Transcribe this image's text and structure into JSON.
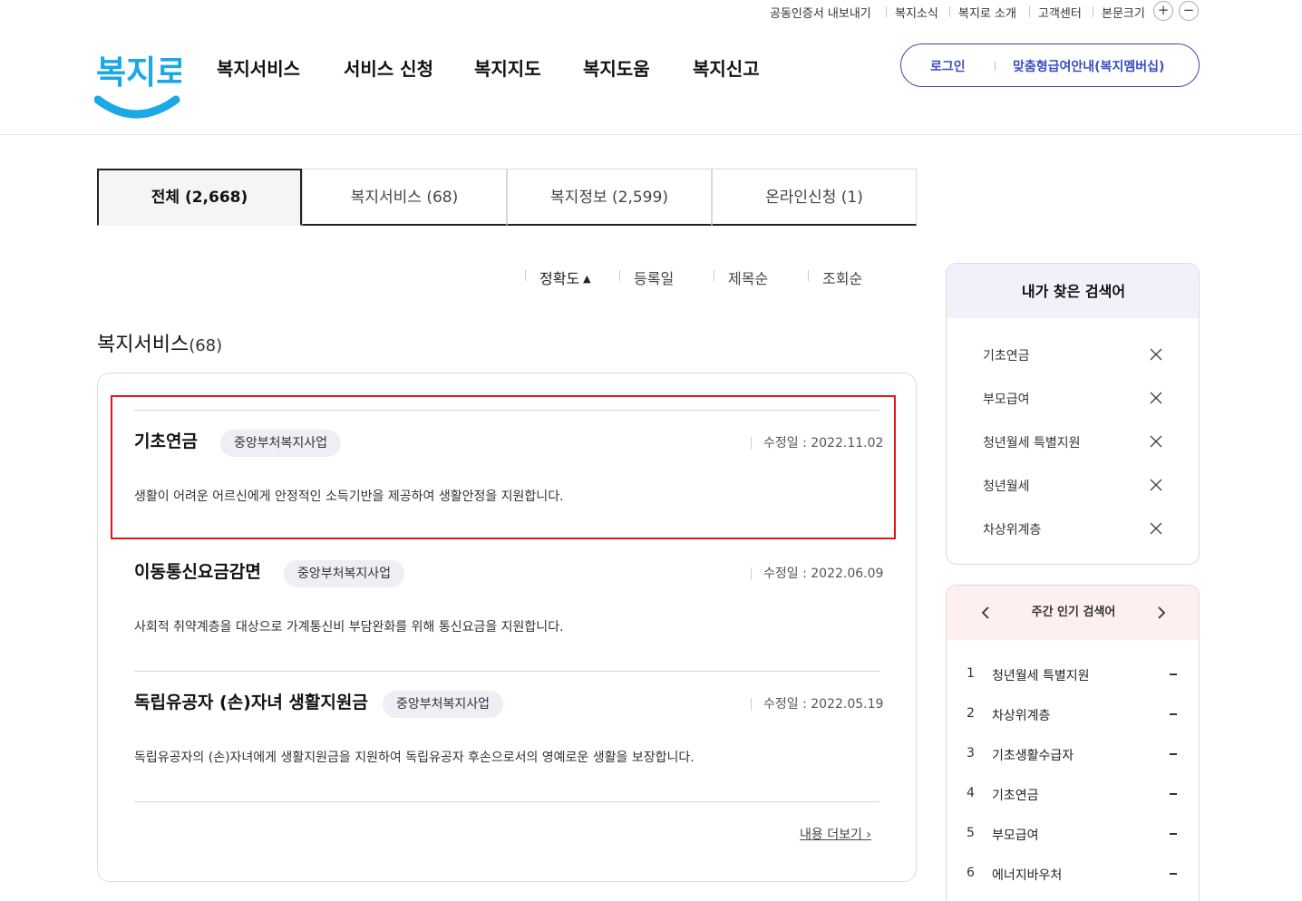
{
  "utility": {
    "items": [
      "공동인증서 내보내기",
      "복지소식",
      "복지로 소개",
      "고객센터",
      "본문크기"
    ],
    "plus": "+",
    "minus": "−"
  },
  "header": {
    "logo_text": "복지로",
    "nav": [
      "복지서비스",
      "서비스 신청",
      "복지지도",
      "복지도움",
      "복지신고"
    ],
    "login": "로그인",
    "guide": "맞춤형급여안내(복지멤버십)"
  },
  "tabs": [
    {
      "label": "전체",
      "count": "(2,668)",
      "active": true
    },
    {
      "label": "복지서비스",
      "count": "(68)",
      "active": false
    },
    {
      "label": "복지정보",
      "count": "(2,599)",
      "active": false
    },
    {
      "label": "온라인신청",
      "count": "(1)",
      "active": false
    }
  ],
  "sort": {
    "options": [
      "정확도",
      "등록일",
      "제목순",
      "조회순"
    ],
    "active_arrow": "▲"
  },
  "section": {
    "title": "복지서비스",
    "count": "(68)"
  },
  "results": [
    {
      "title": "기초연금",
      "badge": "중앙부처복지사업",
      "date_label": "수정일 : ",
      "date": "2022.11.02",
      "desc": "생활이 어려운 어르신에게 안정적인 소득기반을 제공하여 생활안정을 지원합니다."
    },
    {
      "title": "이동통신요금감면",
      "badge": "중앙부처복지사업",
      "date_label": "수정일 : ",
      "date": "2022.06.09",
      "desc": "사회적 취약계층을 대상으로 가계통신비 부담완화를 위해 통신요금을 지원합니다."
    },
    {
      "title": "독립유공자 (손)자녀 생활지원금",
      "badge": "중앙부처복지사업",
      "date_label": "수정일 : ",
      "date": "2022.05.19",
      "desc": "독립유공자의 (손)자녀에게 생활지원금을 지원하여 독립유공자 후손으로서의 영예로운 생활을 보장합니다."
    }
  ],
  "more_label": "내용 더보기 ›",
  "my_searches": {
    "title": "내가 찾은 검색어",
    "terms": [
      "기초연금",
      "부모급여",
      "청년월세 특별지원",
      "청년월세",
      "차상위계층"
    ]
  },
  "weekly_popular": {
    "title": "주간 인기 검색어",
    "items": [
      {
        "rank": "1",
        "term": "청년월세 특별지원"
      },
      {
        "rank": "2",
        "term": "차상위계층"
      },
      {
        "rank": "3",
        "term": "기초생활수급자"
      },
      {
        "rank": "4",
        "term": "기초연금"
      },
      {
        "rank": "5",
        "term": "부모급여"
      },
      {
        "rank": "6",
        "term": "에너지바우처"
      }
    ]
  },
  "colors": {
    "brand_blue": "#3a4ec2",
    "logo_cyan": "#1aa9e6",
    "highlight_red": "#e4161b",
    "popular_head_bg": "#fdf0ee",
    "my_head_bg": "#f1f1f9"
  }
}
